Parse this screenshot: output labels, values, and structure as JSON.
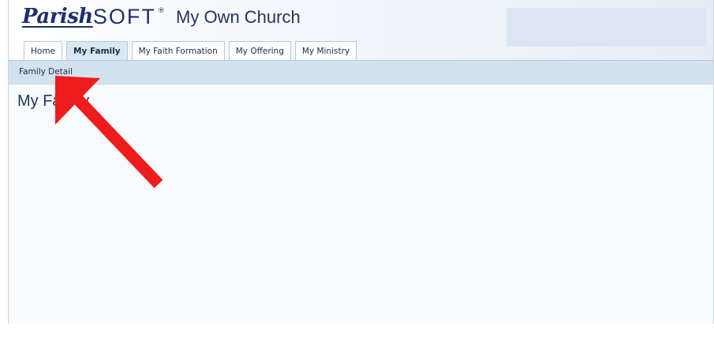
{
  "header": {
    "logo_parish": "Parish",
    "logo_soft": "SOFT",
    "logo_mark": "®",
    "church_name": "My Own Church"
  },
  "tabs": [
    {
      "label": "Home",
      "active": false
    },
    {
      "label": "My Family",
      "active": true
    },
    {
      "label": "My Faith Formation",
      "active": false
    },
    {
      "label": "My Offering",
      "active": false
    },
    {
      "label": "My Ministry",
      "active": false
    }
  ],
  "subnav": {
    "item": "Family Detail"
  },
  "main": {
    "title": "My Family"
  },
  "colors": {
    "brand": "#1e2f6e",
    "subnav_bg": "#d3e2ef",
    "annotation_arrow": "#ee1c1c"
  },
  "annotation": {
    "icon": "red-arrow-icon"
  }
}
